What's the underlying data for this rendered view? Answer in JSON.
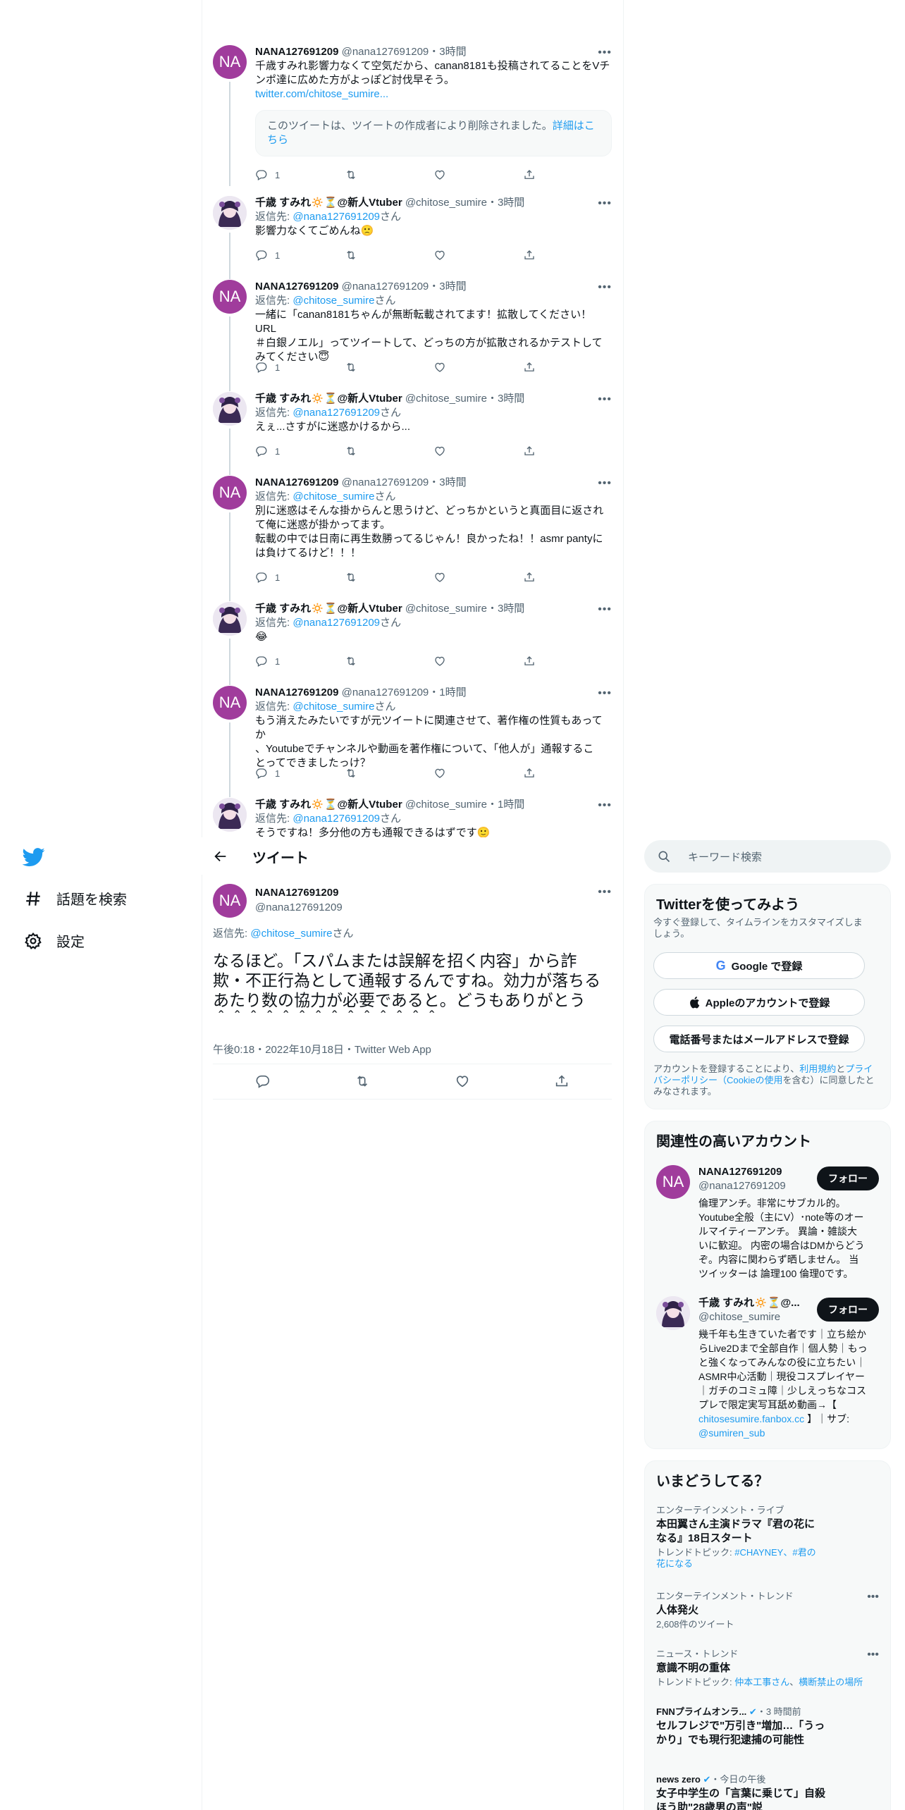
{
  "nav": {
    "explore": "話題を検索",
    "settings": "設定"
  },
  "header": {
    "title": "ツイート"
  },
  "thread": [
    {
      "avatar": "NA",
      "name": "NANA127691209",
      "handle": "@nana127691209",
      "time": "3時間",
      "text": [
        "千歳すみれ影響力なくて空気だから、canan8181も投稿されてることをVチ",
        "ンポ達に広めた方がよっぽど討伐早そう。"
      ],
      "link": "twitter.com/chitose_sumire...",
      "quote": "このツイートは、ツイートの作成者により削除されました。",
      "quote_link": "詳細はこ",
      "quote_link2": "ちら",
      "replies": "1"
    },
    {
      "avatar": "S",
      "name": "千歳 すみれ🔅⏳@新人Vtuber",
      "handle": "@chitose_sumire",
      "time": "3時間",
      "reply_prefix": "返信先: ",
      "reply_to": "@nana127691209",
      "reply_suffix": "さん",
      "text": [
        "影響力なくてごめんね🙁"
      ],
      "replies": "1"
    },
    {
      "avatar": "NA",
      "name": "NANA127691209",
      "handle": "@nana127691209",
      "time": "3時間",
      "reply_prefix": "返信先: ",
      "reply_to": "@chitose_sumire",
      "reply_suffix": "さん",
      "text": [
        "一緒に「canan8181ちゃんが無断転載されてます！拡散してください！URL",
        "＃白銀ノエル」ってツイートして、どっちの方が拡散されるかテストして",
        "みてください😇"
      ],
      "replies": "1"
    },
    {
      "avatar": "S",
      "name": "千歳 すみれ🔅⏳@新人Vtuber",
      "handle": "@chitose_sumire",
      "time": "3時間",
      "reply_prefix": "返信先: ",
      "reply_to": "@nana127691209",
      "reply_suffix": "さん",
      "text": [
        "えぇ...さすがに迷惑かけるから..."
      ],
      "replies": "1"
    },
    {
      "avatar": "NA",
      "name": "NANA127691209",
      "handle": "@nana127691209",
      "time": "3時間",
      "reply_prefix": "返信先: ",
      "reply_to": "@chitose_sumire",
      "reply_suffix": "さん",
      "text": [
        "別に迷惑はそんな掛からんと思うけど、どっちかというと真面目に返され",
        "て俺に迷惑が掛かってます。",
        "転載の中では日南に再生数勝ってるじゃん！良かったね！！asmr pantyに",
        "は負けてるけど！！！"
      ],
      "replies": "1"
    },
    {
      "avatar": "S",
      "name": "千歳 すみれ🔅⏳@新人Vtuber",
      "handle": "@chitose_sumire",
      "time": "3時間",
      "reply_prefix": "返信先: ",
      "reply_to": "@nana127691209",
      "reply_suffix": "さん",
      "text": [
        "😂"
      ],
      "replies": "1"
    },
    {
      "avatar": "NA",
      "name": "NANA127691209",
      "handle": "@nana127691209",
      "time": "1時間",
      "reply_prefix": "返信先: ",
      "reply_to": "@chitose_sumire",
      "reply_suffix": "さん",
      "text": [
        "もう消えたみたいですが元ツイートに関連させて、著作権の性質もあってか",
        "、Youtubeでチャンネルや動画を著作権について、「他人が」通報するこ",
        "とってできましたっけ？"
      ],
      "replies": "1"
    },
    {
      "avatar": "S",
      "name": "千歳 すみれ🔅⏳@新人Vtuber",
      "handle": "@chitose_sumire",
      "time": "1時間",
      "reply_prefix": "返信先: ",
      "reply_to": "@nana127691209",
      "reply_suffix": "さん",
      "text": [
        "そうですね！多分他の方も通報できるはずです🙂"
      ],
      "replies": ""
    }
  ],
  "focal": {
    "avatar": "NA",
    "name": "NANA127691209",
    "handle": "@nana127691209",
    "reply_prefix": "返信先: ",
    "reply_to": "@chitose_sumire",
    "reply_suffix": "さん",
    "text": [
      "なるほど。「スパムまたは誤解を招く内容」から詐",
      "欺・不正行為として通報するんですね。効力が落ちる",
      "あたり数の協力が必要であると。どうもありがとう",
      "＾＾＾＾＾＾＾＾＾＾＾＾＾＾"
    ],
    "meta": "午後0:18・2022年10月18日・Twitter Web App"
  },
  "search": {
    "placeholder": "キーワード検索"
  },
  "signup": {
    "title": "Twitterを使ってみよう",
    "desc": [
      "今すぐ登録して、タイムラインをカスタマイズしま",
      "しょう。"
    ],
    "google": "Google で登録",
    "apple": "Appleのアカウントで登録",
    "phone": "電話番号またはメールアドレスで登録",
    "legal_a": "アカウントを登録することにより、",
    "legal_terms": "利用規約",
    "legal_b": "と",
    "legal_privacy1": "プライ",
    "legal_privacy2": "バシーポリシー（Cookieの使用",
    "legal_c": "を含む）に同意したと",
    "legal_d": "みなされます。"
  },
  "relevant": {
    "title": "関連性の高いアカウント",
    "follow": "フォロー",
    "accounts": [
      {
        "avatar": "NA",
        "name": "NANA127691209",
        "handle": "@nana127691209",
        "bio": [
          "倫理アンチ。非常にサブカル的。",
          "Youtube全般（主にV）･note等のオー",
          "ルマイティーアンチ。 異論・雑談大",
          "いに歓迎。 内密の場合はDMからどう",
          "ぞ。内容に関わらず晒しません。 当",
          "ツイッターは 論理100 倫理0です。"
        ]
      },
      {
        "avatar": "S",
        "name": "千歳 すみれ🔅⏳@...",
        "handle": "@chitose_sumire",
        "bio": [
          "幾千年も生きていた者です｜立ち絵か",
          "らLive2Dまで全部自作｜個人勢｜もっ",
          "と強くなってみんなの役に立ちたい｜",
          "ASMR中心活動｜現役コスプレイヤー",
          "｜ガチのコミュ障｜少しえっちなコス",
          "プレで限定実写耳舐め動画→【"
        ],
        "link": "chitosesumire.fanbox.cc",
        "bio_tail": " 】｜サブ:",
        "link2": "@sumiren_sub"
      }
    ]
  },
  "trends": {
    "title": "いまどうしてる？",
    "items": [
      {
        "cat": "エンターテインメント・ライブ",
        "title": [
          "本田翼さん主演ドラマ『君の花に",
          "なる』18日スタート"
        ],
        "sub_prefix": "トレンドトピック: ",
        "sub_links": [
          "#CHAYNEY",
          "、#君の",
          "花になる"
        ]
      },
      {
        "cat": "エンターテインメント・トレンド",
        "title": [
          "人体発火"
        ],
        "sub": "2,608件のツイート"
      },
      {
        "cat": "ニュース・トレンド",
        "title": [
          "意識不明の重体"
        ],
        "sub_prefix": "トレンドトピック: ",
        "sub_links": [
          "仲本工事さん",
          "、",
          "横断禁止の場所"
        ]
      },
      {
        "source": "FNNプライムオンラ...",
        "time": "・3 時間前",
        "title": [
          "セルフレジで\"万引き\"増加…「うっ",
          "かり」でも現行犯逮捕の可能性"
        ]
      },
      {
        "source": "news zero",
        "time": "・今日の午後",
        "title": [
          "女子中学生の「言葉に乗じて」自殺",
          "ほう助\"28歳男の声\"説"
        ]
      }
    ]
  }
}
